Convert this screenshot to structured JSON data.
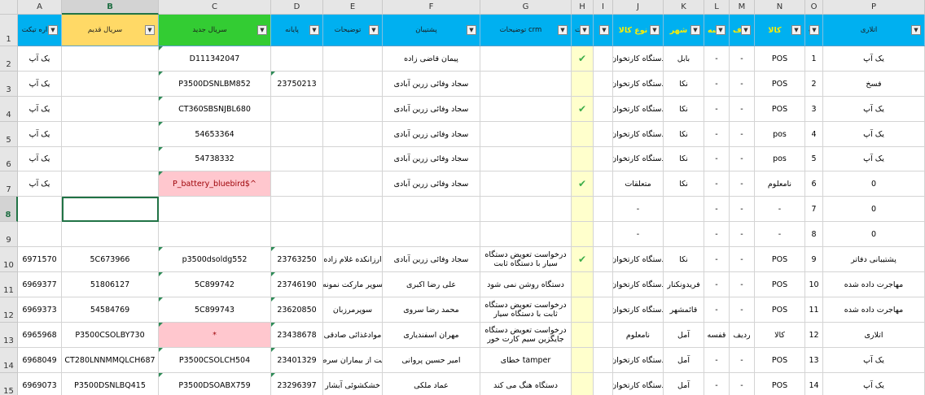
{
  "columns": [
    "A",
    "B",
    "C",
    "D",
    "E",
    "F",
    "G",
    "H",
    "I",
    "J",
    "K",
    "L",
    "M",
    "N",
    "O",
    "P"
  ],
  "selected_column": "B",
  "selected_row": 8,
  "rows": [
    "1",
    "2",
    "3",
    "4",
    "5",
    "6",
    "7",
    "8",
    "9",
    "10",
    "11",
    "12",
    "13",
    "14",
    "15"
  ],
  "header": [
    "اره تیکت",
    "سریال قدیم",
    "سریال جدید",
    "پایانه",
    "توضیحات",
    "پشتیبان",
    "توضیحات crm",
    "ت",
    "",
    "نوع کالا",
    "شهر",
    "ف قفسه",
    "ف",
    "کالا",
    "ردیف",
    "اتلاری"
  ],
  "header_colors": {
    "blue": "#00b0f0",
    "yellow": "#ffd966",
    "green": "#33cc33"
  },
  "check_icon": "check-mark-icon",
  "dropdown_icon": "▼",
  "data": [
    [
      "یک آپ",
      "",
      "D111342047",
      "",
      "",
      "پیمان قاضی زاده",
      "",
      "✔",
      "",
      "دستگاه کارتخوان",
      "بابل",
      "-",
      "-",
      "POS",
      "1",
      "یک آپ"
    ],
    [
      "یک آپ",
      "",
      "P3500DSNLBM852",
      "23750213",
      "",
      "سجاد وفائی زرین آبادی",
      "",
      "",
      "",
      "دستگاه کارتخوان",
      "نکا",
      "-",
      "-",
      "POS",
      "2",
      "فسخ"
    ],
    [
      "یک آپ",
      "",
      "CT360SBSNJBL680",
      "",
      "",
      "سجاد وفائی زرین آبادی",
      "",
      "✔",
      "",
      "دستگاه کارتخوان",
      "نکا",
      "-",
      "-",
      "POS",
      "3",
      "یک آپ"
    ],
    [
      "یک آپ",
      "",
      "54653364",
      "",
      "",
      "سجاد وفائی زرین آبادی",
      "",
      "",
      "",
      "دستگاه کارتخوان",
      "نکا",
      "-",
      "-",
      "pos",
      "4",
      "یک آپ"
    ],
    [
      "یک آپ",
      "",
      "54738332",
      "",
      "",
      "سجاد وفائی زرین آبادی",
      "",
      "",
      "",
      "دستگاه کارتخوان",
      "نکا",
      "-",
      "-",
      "pos",
      "5",
      "یک آپ"
    ],
    [
      "یک آپ",
      "",
      "P_battery_bluebird$^",
      "",
      "",
      "سجاد وفائی زرین آبادی",
      "",
      "✔",
      "",
      "متعلقات",
      "نکا",
      "-",
      "-",
      "نامعلوم",
      "6",
      "0"
    ],
    [
      "",
      "",
      "",
      "",
      "",
      "",
      "",
      "",
      "",
      "-",
      "",
      "-",
      "-",
      "-",
      "7",
      "0"
    ],
    [
      "",
      "",
      "",
      "",
      "",
      "",
      "",
      "",
      "",
      "-",
      "",
      "-",
      "-",
      "-",
      "8",
      "0"
    ],
    [
      "6971570",
      "5C673966",
      "p3500dsoldg552",
      "23763250",
      "ارزانکده غلام زاده",
      "سجاد وفائی زرین آبادی",
      "درخواست تعویض دستگاه سیار با دستگاه ثابت",
      "✔",
      "",
      "دستگاه کارتخوان",
      "نکا",
      "-",
      "-",
      "POS",
      "9",
      "پشتیبانی دفاتر"
    ],
    [
      "6969377",
      "51806127",
      "5C899742",
      "23746190",
      "سوپر مارکت نمونه",
      "علی رضا اکبری",
      "دستگاه روشن نمی شود",
      "",
      "",
      "دستگاه کارتخوان",
      "فریدونکنار",
      "-",
      "-",
      "POS",
      "10",
      "مهاجرت داده شده"
    ],
    [
      "6969373",
      "54584769",
      "5C899743",
      "23620850",
      "سوپرمرزبان",
      "محمد رضا سروی",
      "درخواست تعویض دستگاه ثابت با دستگاه سیار",
      "",
      "",
      "دستگاه کارتخوان",
      "قائمشهر",
      "-",
      "-",
      "POS",
      "11",
      "مهاجرت داده شده"
    ],
    [
      "6965968",
      "P3500CSOLBY730",
      "*",
      "23438678",
      "موادغذائی صادقی",
      "مهران اسفندیاری",
      "درخواست تعویض دستگاه جایگزین سیم کارت خور",
      "",
      "",
      "نامعلوم",
      "آمل",
      "قفسه",
      "ردیف",
      "کالا",
      "12",
      "اتلاری"
    ],
    [
      "6968049",
      "CT280LNNMMQLCH687",
      "P3500CSOLCH504",
      "23401329",
      "حمایت از بیماران سرطانی",
      "امیر حسین پروانی",
      "خطای tamper",
      "",
      "",
      "دستگاه کارتخوان",
      "آمل",
      "-",
      "-",
      "POS",
      "13",
      "یک آپ"
    ],
    [
      "6969073",
      "P3500DSNLBQ415",
      "P3500DSOABX759",
      "23296397",
      "خشکشوئی آبشار",
      "عماد ملکی",
      "دستگاه هنگ می کند",
      "",
      "",
      "دستگاه کارتخوان",
      "آمل",
      "-",
      "-",
      "POS",
      "14",
      "یک آپ"
    ]
  ]
}
